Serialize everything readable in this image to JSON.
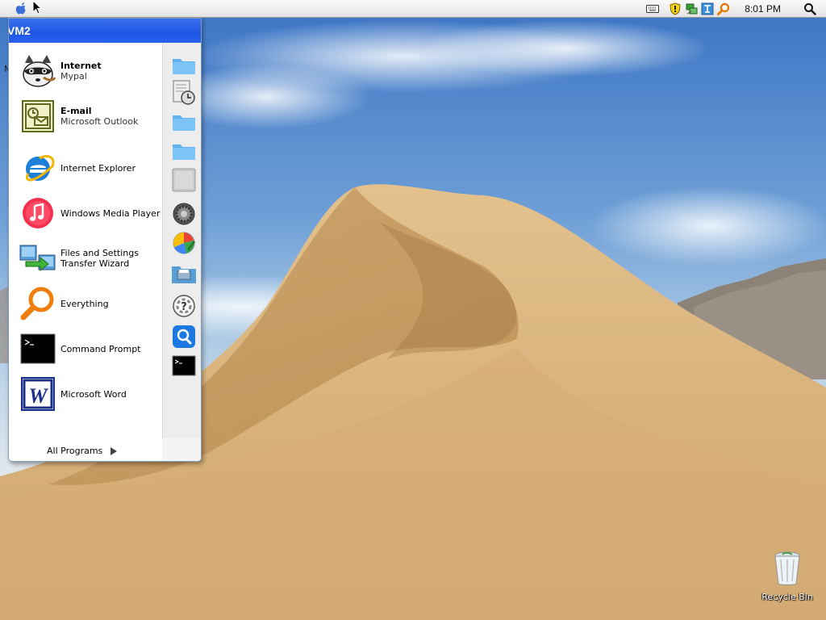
{
  "menubar": {
    "clock": "8:01 PM",
    "tray_icons": [
      "keyboard-icon",
      "security-shield-icon",
      "network-icon",
      "language-icon",
      "search-tool-icon"
    ]
  },
  "start_menu": {
    "user": "VM2",
    "pinned": [
      {
        "title": "Internet",
        "subtitle": "Mypal",
        "icon": "raccoon-browser-icon"
      },
      {
        "title": "E-mail",
        "subtitle": "Microsoft Outlook",
        "icon": "outlook-icon"
      }
    ],
    "items": [
      {
        "label": "Internet Explorer",
        "icon": "internet-explorer-icon"
      },
      {
        "label": "Windows Media Player",
        "icon": "media-player-icon"
      },
      {
        "label_line1": "Files and Settings",
        "label_line2": "Transfer Wizard",
        "icon": "transfer-wizard-icon"
      },
      {
        "label": "Everything",
        "icon": "everything-search-icon"
      },
      {
        "label": "Command Prompt",
        "icon": "command-prompt-icon"
      },
      {
        "label": "Microsoft Word",
        "icon": "word-icon"
      }
    ],
    "all_programs": "All Programs",
    "right_column_icons": [
      "folder-documents-icon",
      "clock-document-icon",
      "folder-pictures-icon",
      "folder-music-icon",
      "computer-icon",
      "settings-icon",
      "control-panel-icon",
      "printers-folder-icon",
      "help-icon",
      "search-icon",
      "run-icon"
    ]
  },
  "desktop": {
    "recycle_bin_label": "Recycle Bin",
    "stray_text": "M"
  }
}
